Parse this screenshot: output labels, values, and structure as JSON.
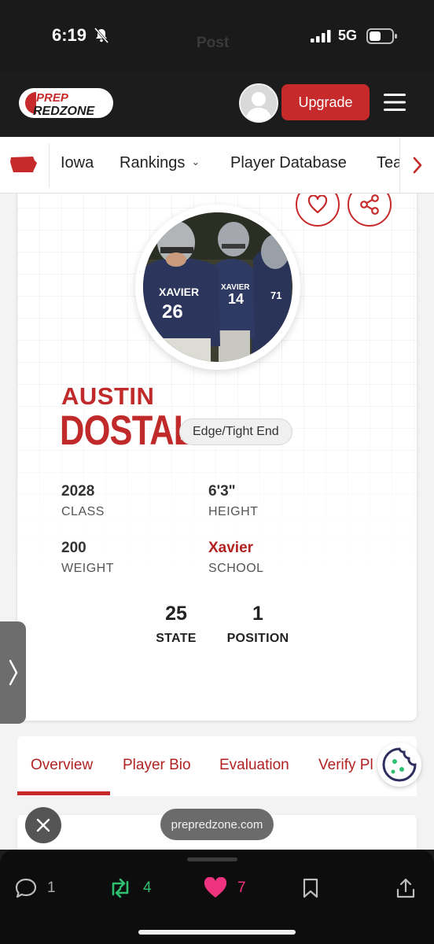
{
  "status_bar": {
    "time": "6:19",
    "network": "5G",
    "background_title": "Post"
  },
  "header": {
    "logo_line1": "PREP",
    "logo_line2": "REDZONE",
    "upgrade_label": "Upgrade"
  },
  "subnav": {
    "items": [
      {
        "label": "Iowa"
      },
      {
        "label": "Rankings"
      },
      {
        "label": "Player Database"
      },
      {
        "label": "Tea"
      }
    ]
  },
  "player": {
    "first_name": "AUSTIN",
    "last_name": "DOSTAL",
    "position": "Edge/Tight End",
    "photo_jersey_text": "XAVIER",
    "photo_numbers": [
      "26",
      "14",
      "71"
    ],
    "stats": [
      {
        "value": "2028",
        "label": "CLASS"
      },
      {
        "value": "6'3\"",
        "label": "HEIGHT"
      },
      {
        "value": "200",
        "label": "WEIGHT"
      },
      {
        "value": "Xavier",
        "label": "SCHOOL"
      }
    ],
    "ranks": [
      {
        "value": "25",
        "label": "STATE"
      },
      {
        "value": "1",
        "label": "POSITION"
      }
    ]
  },
  "tabs": [
    {
      "label": "Overview",
      "active": true
    },
    {
      "label": "Player Bio"
    },
    {
      "label": "Evaluation"
    },
    {
      "label": "Verify Pl"
    }
  ],
  "overlay": {
    "domain": "prepredzone.com"
  },
  "actions": {
    "replies": "1",
    "reposts": "4",
    "likes": "7"
  },
  "colors": {
    "brand_red": "#c62a2a",
    "repost_green": "#2fbf71",
    "like_pink": "#f0337f"
  },
  "icons": [
    "bell-slash-icon",
    "signal-icon",
    "battery-icon",
    "menu-icon",
    "iowa-state-icon",
    "chevron-right-icon",
    "heart-icon",
    "share-icon",
    "cookie-icon",
    "close-icon",
    "reply-icon",
    "repost-icon",
    "like-icon",
    "bookmark-icon",
    "upload-icon"
  ]
}
